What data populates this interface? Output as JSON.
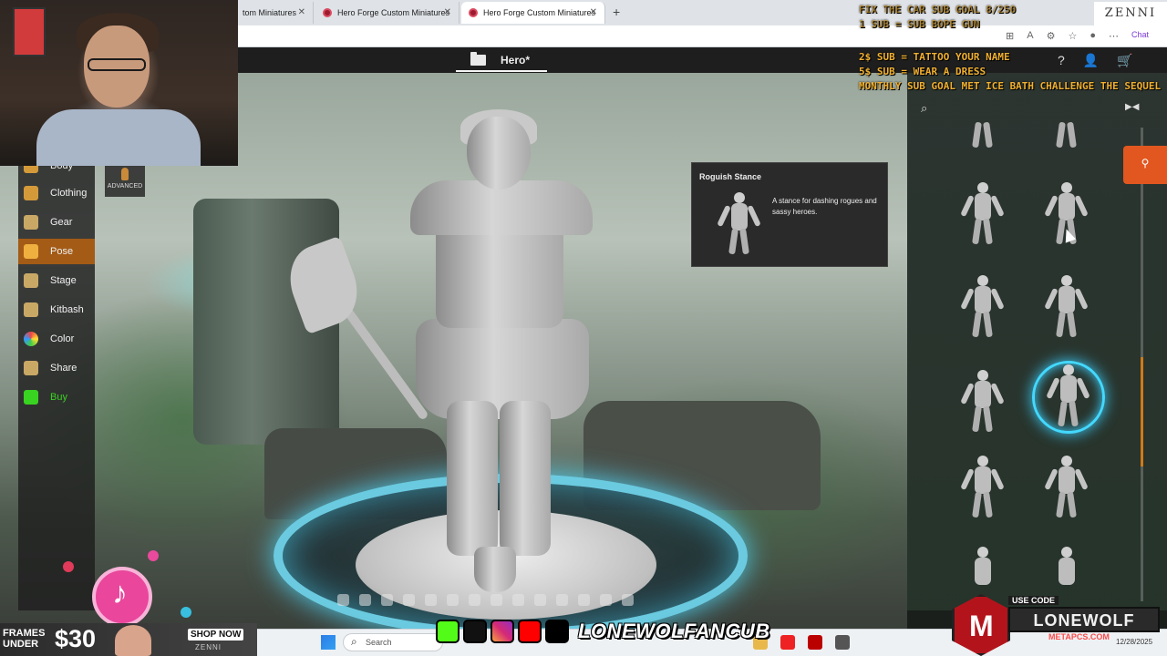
{
  "browser": {
    "tabs": [
      {
        "title": "tom Miniatures"
      },
      {
        "title": "Hero Forge Custom Miniatures"
      },
      {
        "title": "Hero Forge Custom Miniatures"
      }
    ],
    "new_tab": "+",
    "chat_label": "Chat"
  },
  "app": {
    "project_name": "Hero*",
    "advanced_label": "ADVANCED",
    "nav": [
      {
        "label": "Body"
      },
      {
        "label": "Clothing"
      },
      {
        "label": "Gear"
      },
      {
        "label": "Pose"
      },
      {
        "label": "Stage"
      },
      {
        "label": "Kitbash"
      },
      {
        "label": "Color"
      },
      {
        "label": "Share"
      },
      {
        "label": "Buy"
      }
    ],
    "active_nav": "Pose"
  },
  "tooltip": {
    "title": "Roguish Stance",
    "description": "A stance for dashing rogues and sassy heroes."
  },
  "stream": {
    "goals": [
      "FIX THE CAR SUB GOAL 8/250",
      "1 SUB = SUB BOPE GUN",
      "",
      "2$ SUB = TATTOO YOUR NAME",
      "5$ SUB = WEAR A DRESS",
      "MONTHLY SUB GOAL MET ICE BATH CHALLENGE THE SEQUEL"
    ],
    "zenni_brand": "ZENNI",
    "promo": {
      "line1": "FRAMES",
      "line2": "UNDER",
      "price": "$30",
      "shop_label": "SHOP NOW",
      "brand": "ZENNI"
    },
    "handle": "LONEWOLFANCUB",
    "sponsor": {
      "use_code_label": "USE CODE",
      "code": "LONEWOLF",
      "site": "METAPCS.COM"
    }
  },
  "taskbar": {
    "search_placeholder": "Search",
    "date": "12/28/2025"
  },
  "colors": {
    "accent_orange": "#a35b16",
    "buy_green": "#39d321",
    "selection_cyan": "#43d9ff",
    "goal_text": "#f0b030"
  }
}
